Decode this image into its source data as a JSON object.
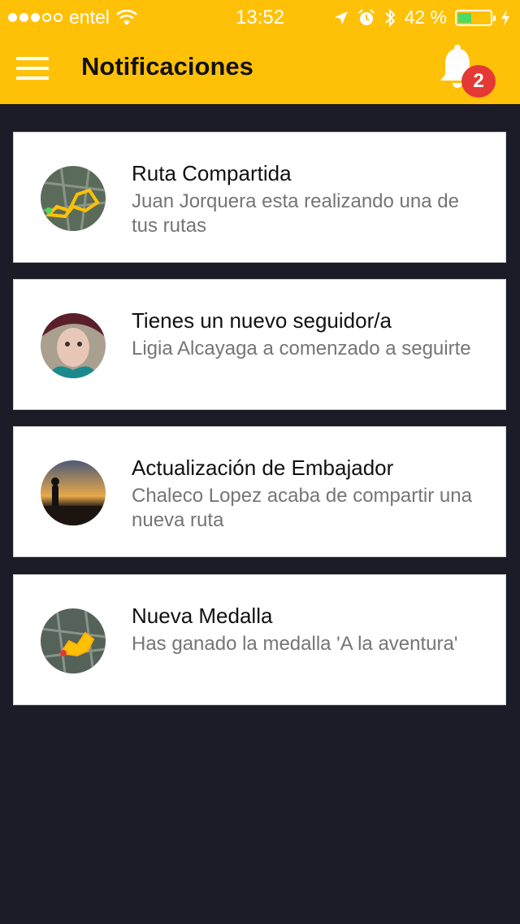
{
  "status_bar": {
    "carrier": "entel",
    "time": "13:52",
    "battery": "42 %",
    "battery_level": 0.42,
    "signal_bars": 3
  },
  "header": {
    "title": "Notificaciones",
    "badge_count": "2",
    "accent_color": "#ffc107",
    "badge_color": "#e53935"
  },
  "notifications": [
    {
      "title": "Ruta Compartida",
      "body": "Juan Jorquera esta realizando una de tus rutas",
      "avatar": "map-route-avatar"
    },
    {
      "title": "Tienes un nuevo seguidor/a",
      "body": "Ligia Alcayaga a comenzado a seguirte",
      "avatar": "user-photo-avatar"
    },
    {
      "title": "Actualización de Embajador",
      "body": "Chaleco Lopez acaba de compartir una nueva ruta",
      "avatar": "sunset-photo-avatar"
    },
    {
      "title": "Nueva Medalla",
      "body": "Has ganado la medalla 'A la aventura'",
      "avatar": "medal-map-avatar"
    }
  ]
}
